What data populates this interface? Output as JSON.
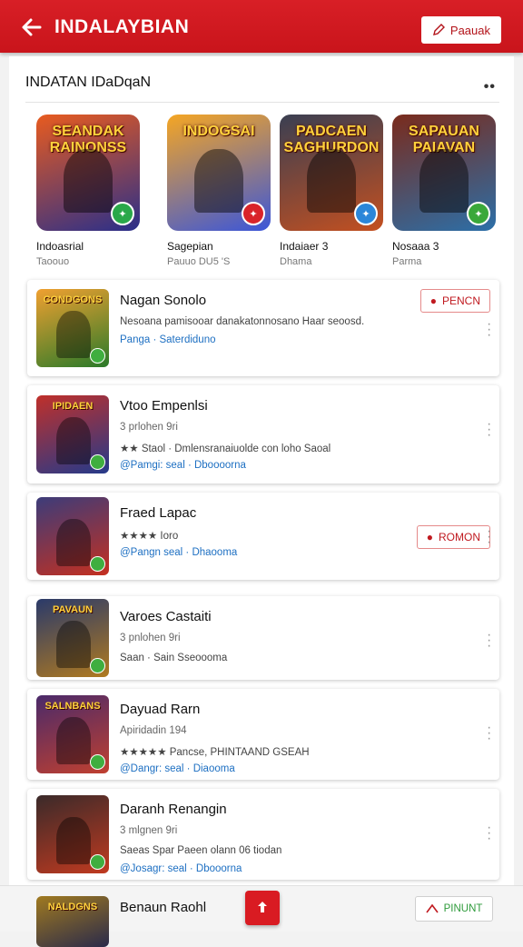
{
  "header": {
    "title": "INDALAYBIAN",
    "action_label": "Paauak"
  },
  "section": {
    "title": "INDATAN IDaDqaN"
  },
  "featured": [
    {
      "art": "SEANDAK RAINONSS",
      "name": "Indoasrial",
      "sub": "Taoouo",
      "bg": [
        "#e85b1f",
        "#2a2f8a"
      ],
      "badge_color": "#2aa84a"
    },
    {
      "art": "INDOGSAI",
      "name": "Sagepian",
      "sub": "Pauuo DU5 'S",
      "bg": [
        "#f5a623",
        "#3b56d9"
      ],
      "badge_color": "#d9242a"
    },
    {
      "art": "PADCAEN SAGHURDON",
      "name": "Indaiaer 3",
      "sub": "Dhama",
      "bg": [
        "#3a3f52",
        "#c45020"
      ],
      "badge_color": "#2b86d9"
    },
    {
      "art": "SAPAUAN PAIAVAN",
      "name": "Nosaaa 3",
      "sub": "Parma",
      "bg": [
        "#7a2b1c",
        "#2c6fa8"
      ],
      "badge_color": "#3aa83a"
    }
  ],
  "cards": [
    {
      "name": "Nagan Sonolo",
      "line1": "Nesoana pamisooar danakatonnosano Haar seoosd.",
      "line2": "Panga · Saterdiduno",
      "art": "CONDGONS",
      "bg": [
        "#f0a030",
        "#2a7a2a"
      ],
      "action": "PENCN"
    },
    {
      "name": "Vtoo Empenlsi",
      "line0": "3 prlohen 9ri",
      "line1": "★★ Staol · Dmlensranaiuolde con loho Saoal",
      "line2": "@Pamgi: seal · Dboooorna",
      "art": "IPIDAEN",
      "bg": [
        "#c0302a",
        "#253a8a"
      ]
    },
    {
      "name": "Fraed Lapac",
      "line1": "★★★★ Ioro",
      "line2": "@Pangn seal · Dhaooma",
      "art": "",
      "bg": [
        "#3c3c7a",
        "#c43020"
      ],
      "action": "ROMON"
    },
    {
      "name": "Varoes Castaiti",
      "line0": "3 pnlohen 9ri",
      "line1": "Saan · Sain Sseoooma",
      "art": "PAVAUN",
      "bg": [
        "#2a3a6a",
        "#b07a20"
      ]
    },
    {
      "name": "Dayuad Rarn",
      "line0": "Apiridadin 194",
      "line1": "★★★★★ Pancse, PHINTAAND GSEAH",
      "line2": "@Dangr: seal · Diaooma",
      "art": "SALNBANS",
      "bg": [
        "#4a2a6a",
        "#c04030"
      ]
    },
    {
      "name": "Daranh Renangin",
      "line0": "3 mlgnen 9ri",
      "line1": "Saeas Spar Paeen olann 06 tiodan",
      "line2": "@Josagr: seal · Dbooorna",
      "art": "",
      "bg": [
        "#3a2a2a",
        "#c03a20"
      ]
    }
  ],
  "bottom": {
    "name": "Benaun Raohl",
    "art": "NALDGNS",
    "button_label": "PINUNT"
  }
}
